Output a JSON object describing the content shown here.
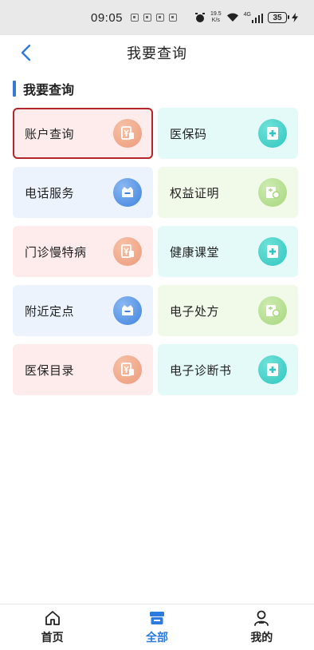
{
  "status_bar": {
    "time": "09:05",
    "speed_value": "19.5",
    "speed_unit": "K/s",
    "network": "4G",
    "battery": "35"
  },
  "header": {
    "title": "我要查询",
    "back_icon": "chevron-left-icon"
  },
  "section": {
    "title": "我要查询"
  },
  "tiles": [
    {
      "label": "账户查询",
      "icon": "ledger-icon",
      "bg": "pink",
      "icon_color": "orange",
      "selected": true
    },
    {
      "label": "医保码",
      "icon": "medical-kit-icon",
      "bg": "cyan",
      "icon_color": "teal"
    },
    {
      "label": "电话服务",
      "icon": "tray-icon",
      "bg": "blue",
      "icon_color": "blue"
    },
    {
      "label": "权益证明",
      "icon": "certificate-icon",
      "bg": "green",
      "icon_color": "lime"
    },
    {
      "label": "门诊慢特病",
      "icon": "ledger-icon",
      "bg": "pink",
      "icon_color": "orange"
    },
    {
      "label": "健康课堂",
      "icon": "medical-kit-icon",
      "bg": "cyan",
      "icon_color": "teal"
    },
    {
      "label": "附近定点",
      "icon": "tray-icon",
      "bg": "blue",
      "icon_color": "blue"
    },
    {
      "label": "电子处方",
      "icon": "certificate-icon",
      "bg": "green",
      "icon_color": "lime"
    },
    {
      "label": "医保目录",
      "icon": "ledger-icon",
      "bg": "pink",
      "icon_color": "orange"
    },
    {
      "label": "电子诊断书",
      "icon": "medical-kit-icon",
      "bg": "cyan",
      "icon_color": "teal"
    }
  ],
  "bottom_nav": {
    "home": "首页",
    "all": "全部",
    "mine": "我的",
    "active": "all"
  },
  "colors": {
    "accent": "#2d7be0",
    "selected_border": "#b3262a"
  }
}
